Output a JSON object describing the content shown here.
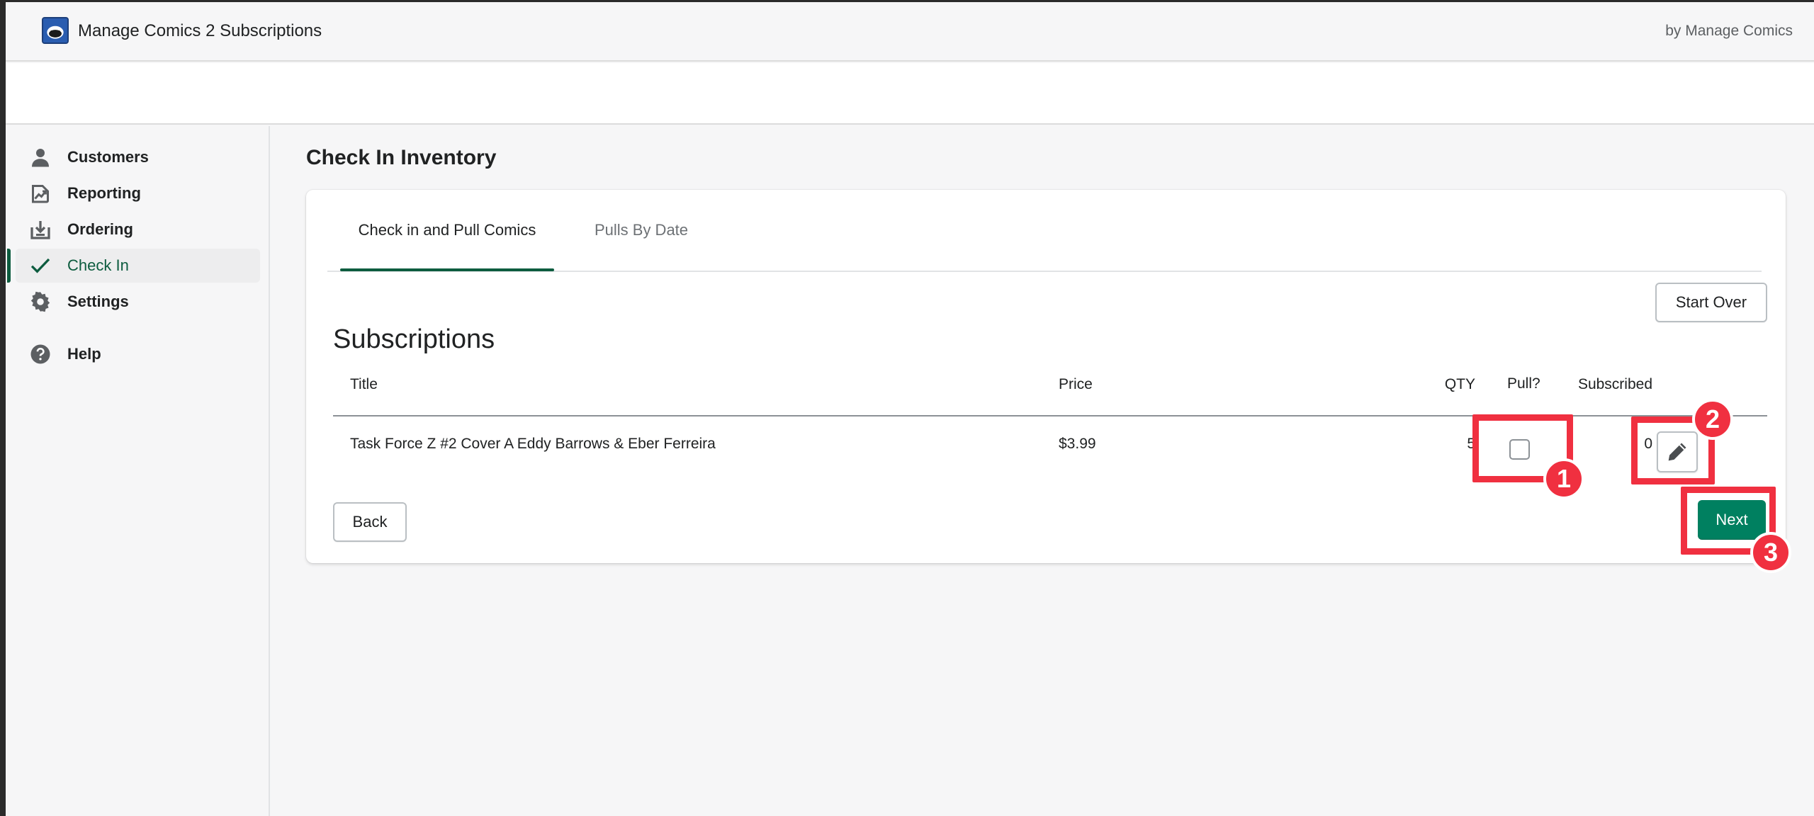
{
  "app": {
    "title": "Manage Comics 2 Subscriptions",
    "byline": "by Manage Comics"
  },
  "sidebar": {
    "items": [
      {
        "label": "Customers",
        "icon": "person-icon"
      },
      {
        "label": "Reporting",
        "icon": "report-icon"
      },
      {
        "label": "Ordering",
        "icon": "import-icon"
      },
      {
        "label": "Check In",
        "icon": "checkmark-icon",
        "active": true
      },
      {
        "label": "Settings",
        "icon": "gear-icon"
      },
      {
        "label": "Help",
        "icon": "question-icon"
      }
    ]
  },
  "page": {
    "title": "Check In Inventory"
  },
  "tabs": [
    {
      "label": "Check in and Pull Comics",
      "active": true
    },
    {
      "label": "Pulls By Date",
      "active": false
    }
  ],
  "buttons": {
    "start_over": "Start Over",
    "back": "Back",
    "next": "Next"
  },
  "subscriptions": {
    "title": "Subscriptions",
    "columns": {
      "title": "Title",
      "price": "Price",
      "qty": "QTY",
      "subscribed": "Subscribed",
      "pull": "Pull?"
    },
    "rows": [
      {
        "title": "Task Force Z #2 Cover A Eddy Barrows & Eber Ferreira",
        "price": "$3.99",
        "qty": "5",
        "subscribed": "0",
        "pull": false
      }
    ]
  },
  "annotations": [
    "1",
    "2",
    "3"
  ],
  "colors": {
    "accent": "#0d5c3f",
    "primary_button": "#008060",
    "annotation": "#f03040"
  }
}
